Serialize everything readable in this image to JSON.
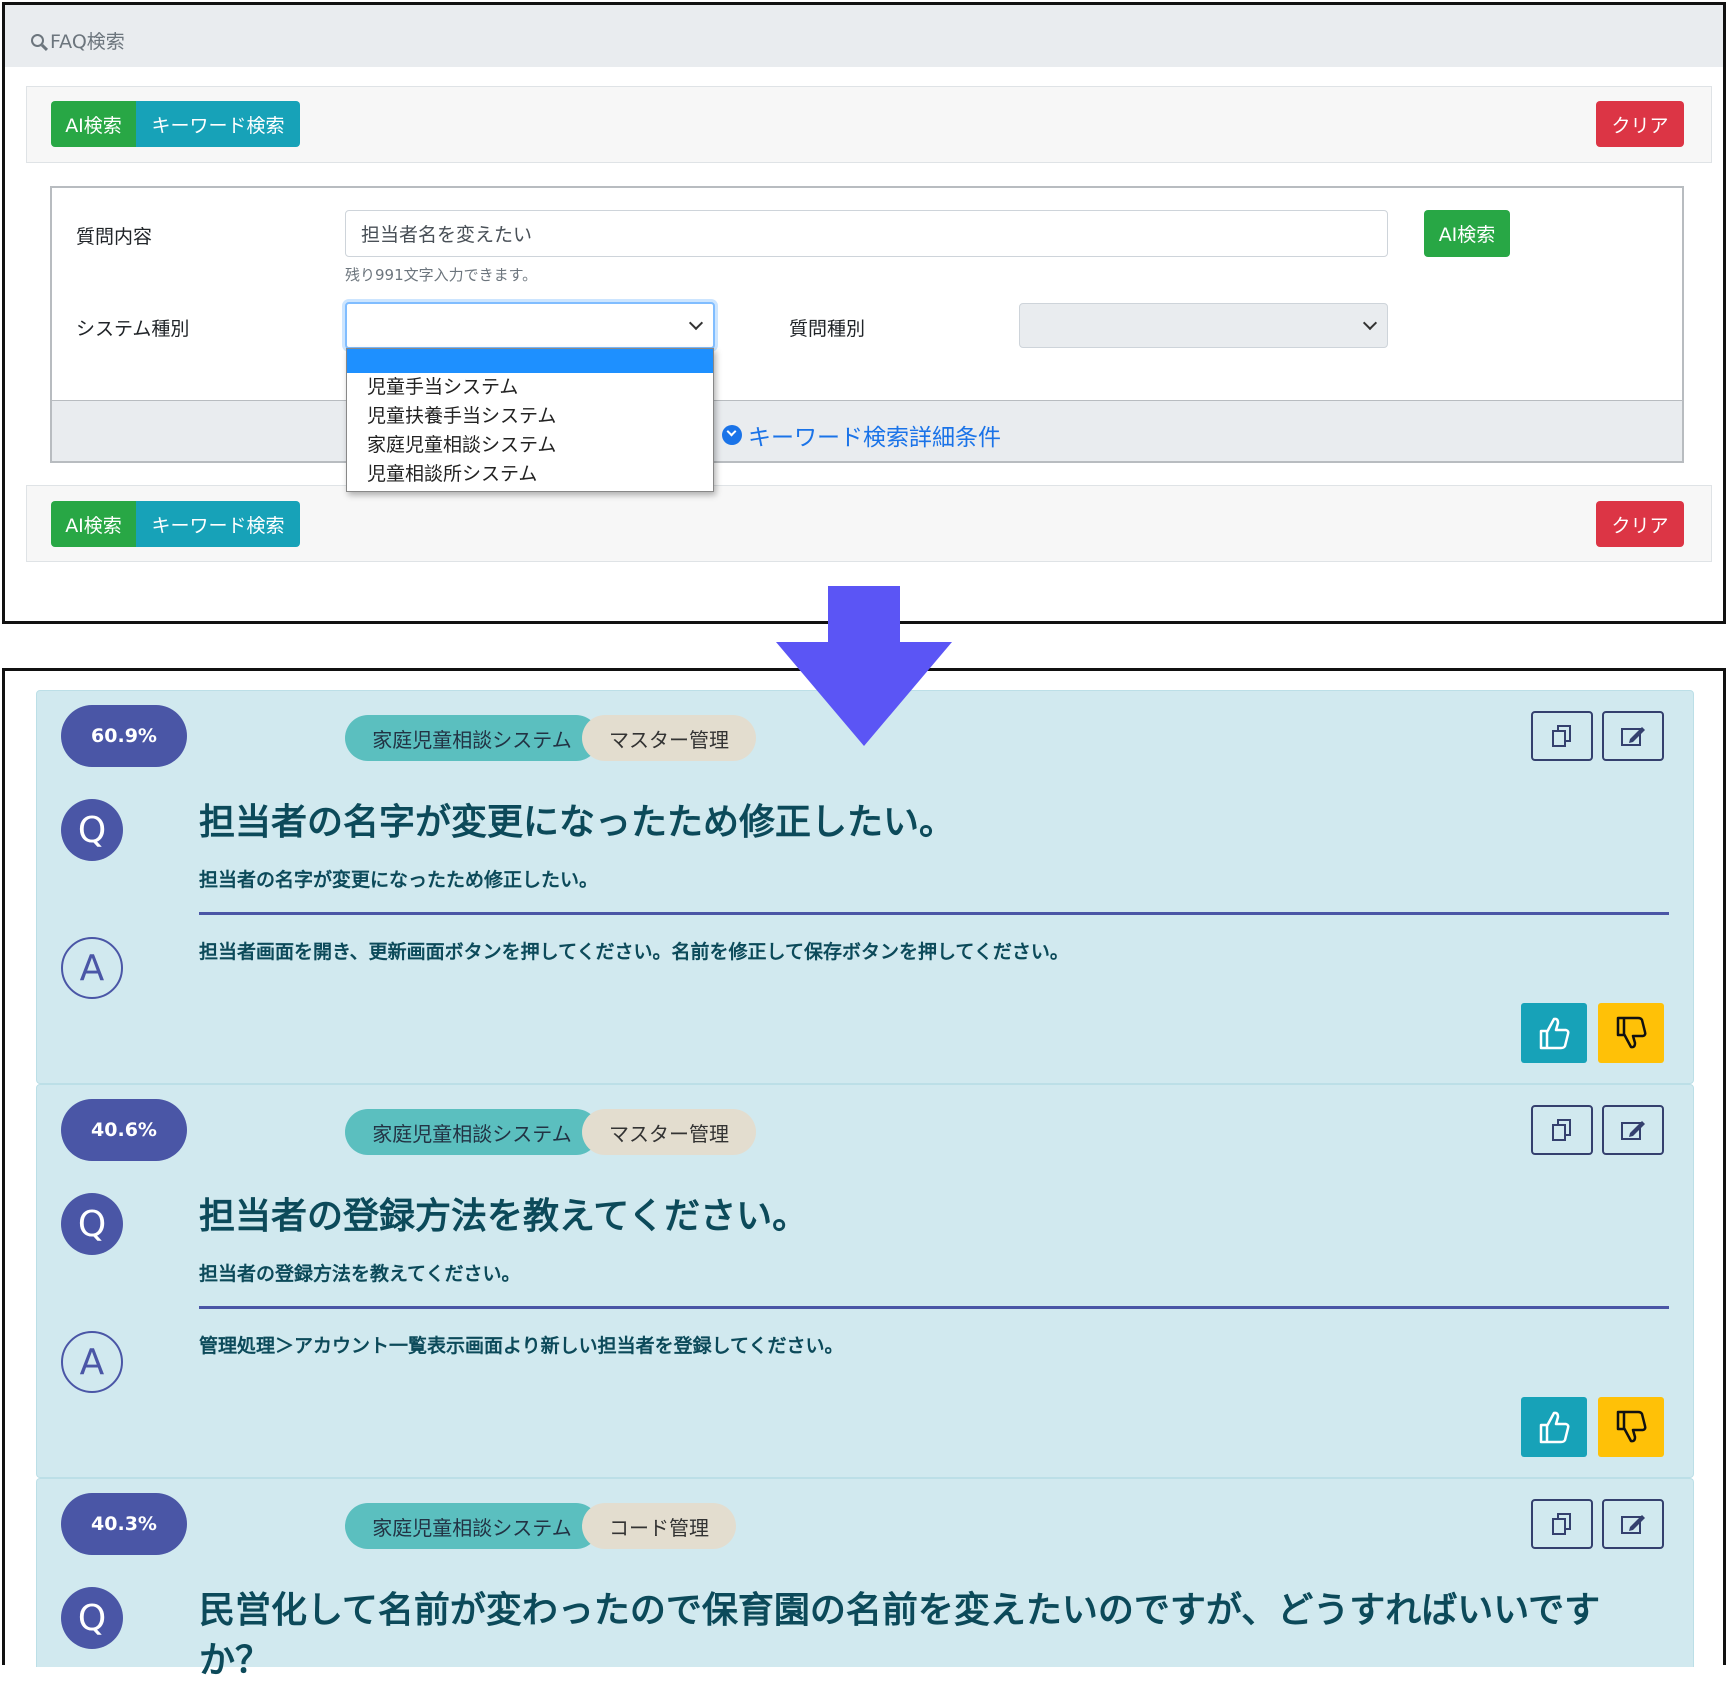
{
  "search_panel": {
    "header": "FAQ検索",
    "top_buttons": {
      "ai": "AI検索",
      "keyword": "キーワード検索",
      "clear": "クリア"
    },
    "question_label": "質問内容",
    "question_value": "担当者名を変えたい",
    "question_hint": "残り991文字入力できます。",
    "ai_search_button": "AI検索",
    "system_type_label": "システム種別",
    "system_type_value": "",
    "system_type_options": [
      "",
      "児童手当システム",
      "児童扶養手当システム",
      "家庭児童相談システム",
      "児童相談所システム"
    ],
    "question_type_label": "質問種別",
    "question_type_value": "",
    "keyword_detail_link": "キーワード検索詳細条件",
    "bottom_buttons": {
      "ai": "AI検索",
      "keyword": "キーワード検索",
      "clear": "クリア"
    }
  },
  "arrow": {
    "color": "#5b55f5"
  },
  "results": [
    {
      "score": "60.9%",
      "system_tag": "家庭児童相談システム",
      "category_tag": "マスター管理",
      "q_mark": "Q",
      "a_mark": "A",
      "question_title": "担当者の名字が変更になったため修正したい。",
      "question_body": "担当者の名字が変更になったため修正したい。",
      "answer": "担当者画面を開き、更新画面ボタンを押してください。名前を修正して保存ボタンを押してください。"
    },
    {
      "score": "40.6%",
      "system_tag": "家庭児童相談システム",
      "category_tag": "マスター管理",
      "q_mark": "Q",
      "a_mark": "A",
      "question_title": "担当者の登録方法を教えてください。",
      "question_body": "担当者の登録方法を教えてください。",
      "answer": "管理処理＞アカウント一覧表示画面より新しい担当者を登録してください。"
    },
    {
      "score": "40.3%",
      "system_tag": "家庭児童相談システム",
      "category_tag": "コード管理",
      "q_mark": "Q",
      "question_title_line1": "民営化して名前が変わったので保育園の名前を変えたいのですが、どうすればいいです",
      "question_title_line2": "か？"
    }
  ],
  "colors": {
    "primary_navy": "#4a56a6",
    "result_bg": "#d1e9ef",
    "green": "#28a745",
    "teal": "#17a2b8",
    "red": "#dc3545",
    "yellow": "#ffc107"
  }
}
